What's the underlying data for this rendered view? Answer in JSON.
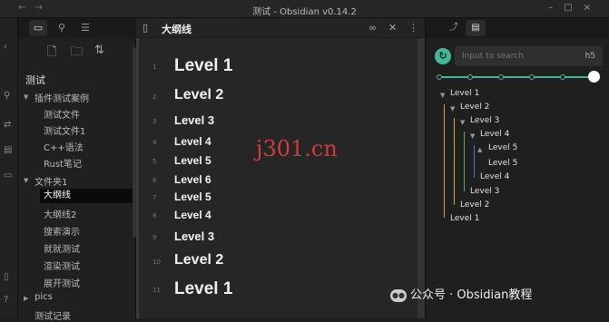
{
  "window": {
    "title": "测试 - Obsidian v0.14.2"
  },
  "left": {
    "root": "测试",
    "folder1": "插件测试案例",
    "folder1_items": [
      "测试文件",
      "测试文件1",
      "C++语法",
      "Rust笔记"
    ],
    "folder2": "文件夹1",
    "folder2_items": [
      "大纲线",
      "大纲线2",
      "搜索演示",
      "就就测试",
      "渲染测试",
      "展开测试"
    ],
    "folder3": "pics",
    "last_item": "测试记录"
  },
  "editor": {
    "title": "大纲线",
    "lines": [
      {
        "n": "1",
        "t": "Level 1"
      },
      {
        "n": "2",
        "t": "Level 2"
      },
      {
        "n": "3",
        "t": "Level 3"
      },
      {
        "n": "4",
        "t": "Level 4"
      },
      {
        "n": "5",
        "t": "Level 5"
      },
      {
        "n": "6",
        "t": "Level 6"
      },
      {
        "n": "7",
        "t": "Level 5"
      },
      {
        "n": "8",
        "t": "Level 4"
      },
      {
        "n": "9",
        "t": "Level 3"
      },
      {
        "n": "10",
        "t": "Level 2"
      },
      {
        "n": "11",
        "t": "Level 1"
      }
    ]
  },
  "right": {
    "search_placeholder": "Input to search",
    "heading_level": "h5",
    "outline": [
      "Level 1",
      "Level 2",
      "Level 3",
      "Level 4",
      "Level 5",
      "Level 5",
      "Level 4",
      "Level 3",
      "Level 2",
      "Level 1"
    ],
    "colors": {
      "accent": "#3fb99a",
      "orange": "#e0a030",
      "yellow": "#c8b020",
      "green": "#52b352",
      "blue": "#3a7fd0"
    }
  },
  "overlay": {
    "watermark": "j301.cn",
    "wechat": "公众号 · Obsidian教程"
  }
}
